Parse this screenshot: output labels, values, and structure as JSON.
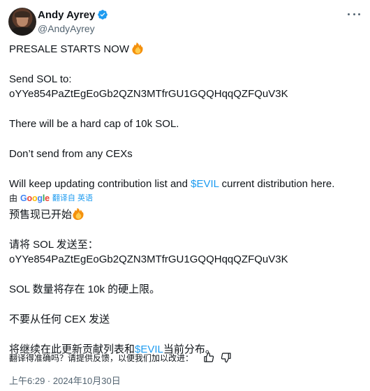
{
  "author": {
    "display_name": "Andy Ayrey",
    "handle": "@AndyAyrey",
    "verified_icon": "verified-badge-icon",
    "avatar": "profile-photo"
  },
  "menu": {
    "more_icon": "more-dots-icon"
  },
  "tweet": {
    "line1": "PRESALE STARTS NOW",
    "line2": "Send SOL to:",
    "line3": "oYYe854PaZtEgEoGb2QZN3MTfrGU1GQQHqqQZFQuV3K",
    "line4": "There will be a hard cap of 10k SOL.",
    "line5": "Don’t send from any CEXs",
    "line6_pre": "Will keep updating contribution list and ",
    "line6_link": "$EVIL",
    "line6_post": " current distribution here."
  },
  "translation_bar": {
    "prefix": "由",
    "google_letters": [
      "G",
      "o",
      "o",
      "g",
      "l",
      "e"
    ],
    "note": "翻译自 英语"
  },
  "translation": {
    "line1": "预售现已开始",
    "line2": "请将 SOL 发送至：",
    "line3": "oYYe854PaZtEgEoGb2QZN3MTfrGU1GQQHqqQZFQuV3K",
    "line4": "SOL 数量将存在 10k 的硬上限。",
    "line5": "不要从任何 CEX 发送",
    "line6_pre": "将继续在此更新贡献列表和",
    "line6_link": "$EVIL",
    "line6_post": "当前分布。"
  },
  "feedback": {
    "question": "翻译得准确吗？请提供反馈，以便我们加以改进：",
    "thumbs_up_icon": "thumbs-up-icon",
    "thumbs_down_icon": "thumbs-down-icon"
  },
  "timestamp": "上午6:29 · 2024年10月30日",
  "colors": {
    "link": "#1d9bf0",
    "text": "#0f1419",
    "secondary": "#536471",
    "fire": "#f4900c"
  }
}
